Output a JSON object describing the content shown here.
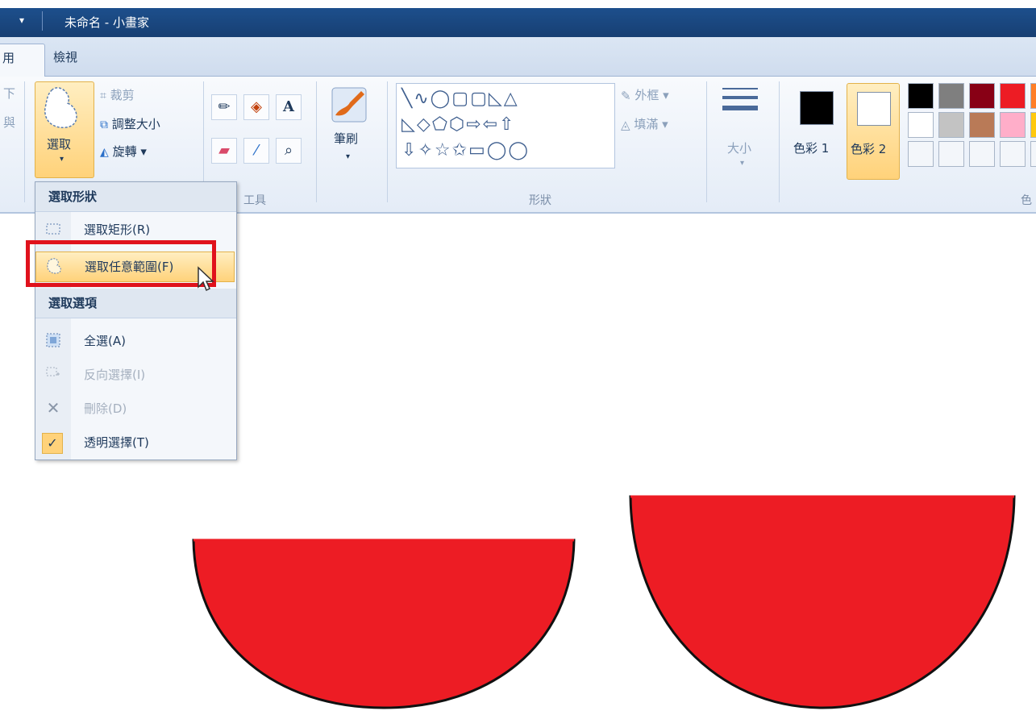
{
  "window": {
    "quick_access": "▾",
    "title": "未命名 - 小畫家"
  },
  "tabs": [
    {
      "label": "用"
    },
    {
      "label": "檢視"
    }
  ],
  "ribbon": {
    "clipboard_partial": [
      "下",
      "與"
    ],
    "image": {
      "select_label": "選取",
      "select_arrow": "▾",
      "crop_label": "裁剪",
      "resize_label": "調整大小",
      "rotate_label": "旋轉 ▾"
    },
    "tools": {
      "group_label": "工具"
    },
    "brushes": {
      "label": "筆刷",
      "arrow": "▾"
    },
    "shapes": {
      "group_label": "形狀",
      "row1": "╲∿◯▢▢◺△",
      "row2": "◺◇⬠⬡⇨⇦⇧",
      "row3": "⇩✧☆✩▭◯◯",
      "outline_label": "外框 ▾",
      "fill_label": "填滿 ▾"
    },
    "size": {
      "label": "大小",
      "arrow": "▾"
    },
    "colors": {
      "color1_label": "色彩 1",
      "color2_label": "色彩 2",
      "color1": "#000000",
      "color2": "#ffffff",
      "group_label_partial": "色",
      "palette_row1": [
        "#000000",
        "#7f7f7f",
        "#880015",
        "#ed1c24",
        "#ff7f27"
      ],
      "palette_row2": [
        "#ffffff",
        "#c3c3c3",
        "#b97a57",
        "#ffaec9",
        "#ffc90e"
      ]
    }
  },
  "menu": {
    "header_shape": "選取形狀",
    "rect_select": "選取矩形(R)",
    "freeform_select": "選取任意範圍(F)",
    "header_options": "選取選項",
    "select_all": "全選(A)",
    "invert_selection": "反向選擇(I)",
    "delete": "刪除(D)",
    "transparent_selection": "透明選擇(T)"
  },
  "canvas": {
    "shape_fill": "#ed1c24",
    "shape_stroke": "#111111"
  }
}
